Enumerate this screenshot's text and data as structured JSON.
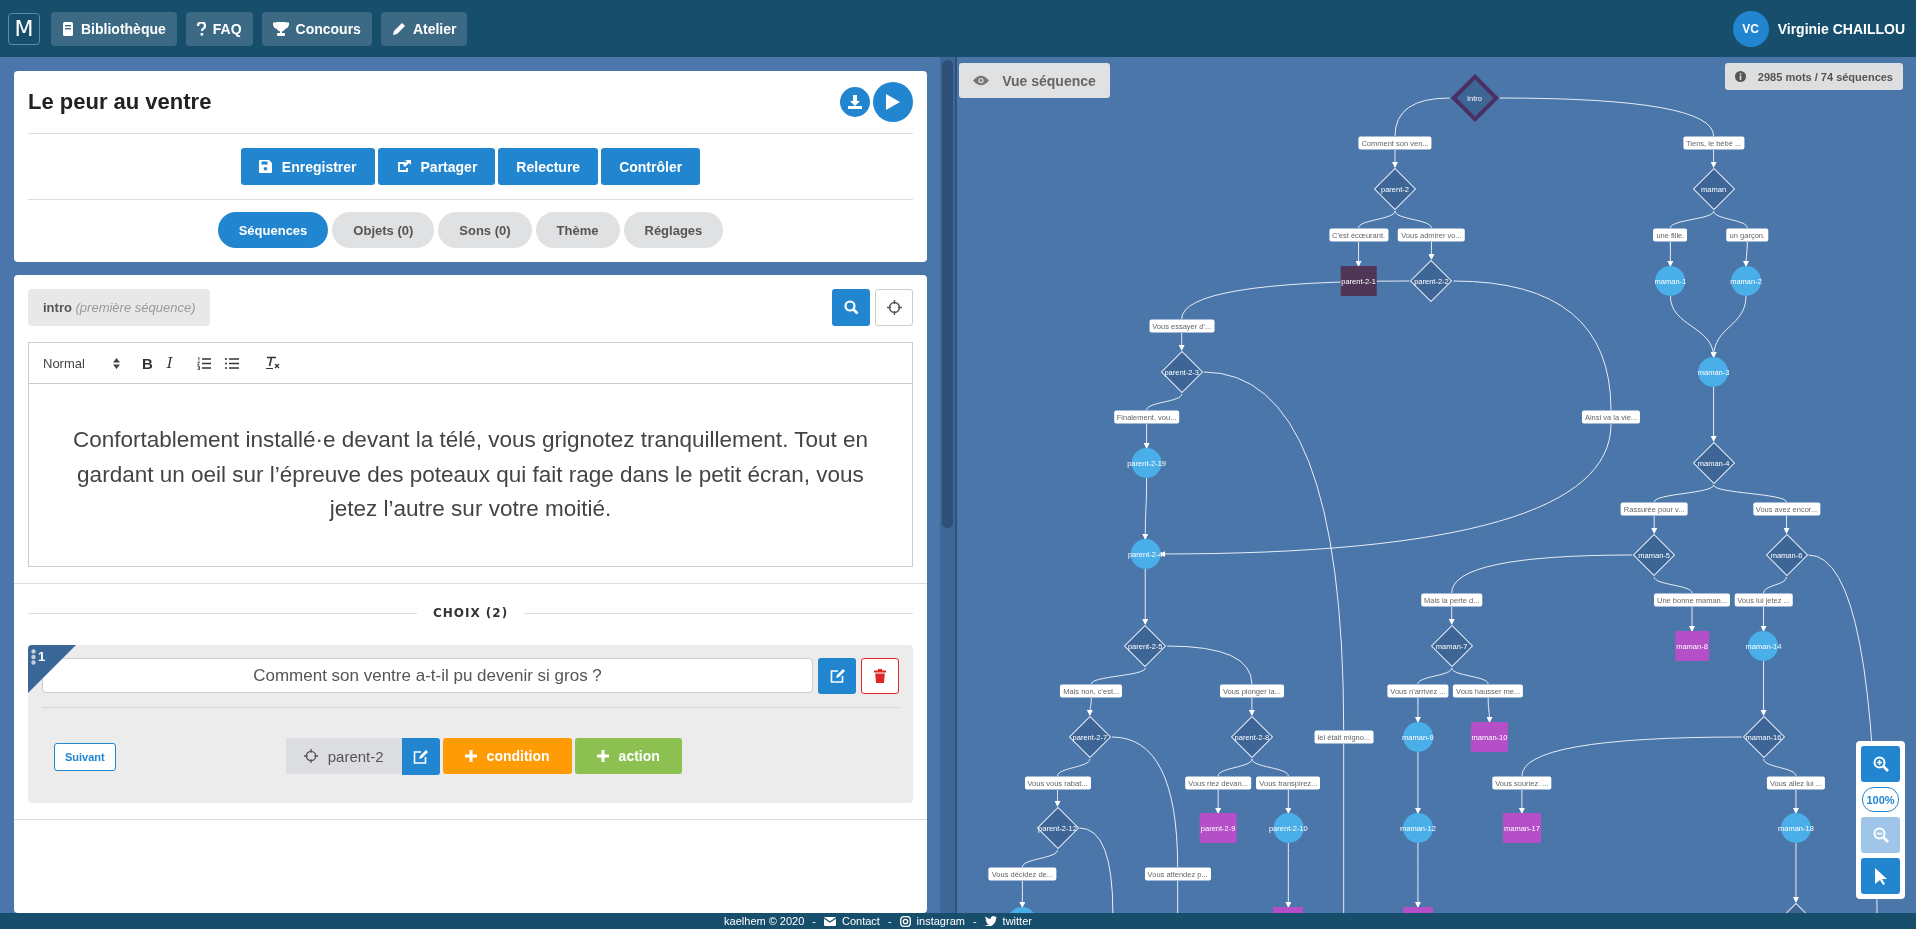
{
  "nav": {
    "logo": "M",
    "items": [
      {
        "label": "Bibliothèque"
      },
      {
        "label": "FAQ"
      },
      {
        "label": "Concours"
      },
      {
        "label": "Atelier"
      }
    ],
    "user": {
      "initials": "VC",
      "name": "Virginie CHAILLOU"
    }
  },
  "story": {
    "title": "Le peur au ventre",
    "actions": [
      "Enregistrer",
      "Partager",
      "Relecture",
      "Contrôler"
    ],
    "tabs": [
      {
        "label": "Séquences",
        "selected": true
      },
      {
        "label": "Objets (0)",
        "selected": false
      },
      {
        "label": "Sons (0)",
        "selected": false
      },
      {
        "label": "Thème",
        "selected": false
      },
      {
        "label": "Réglages",
        "selected": false
      }
    ]
  },
  "sequence": {
    "name": "intro",
    "note": "(première séquence)",
    "toolbar": {
      "format": "Normal",
      "marks": [
        "B",
        "I"
      ]
    },
    "text": "Confortablement installé·e devant la télé, vous grignotez tranquillement. Tout en gardant un oeil sur l’épreuve des poteaux qui fait rage dans le petit écran, vous jetez l’autre sur votre moitié.",
    "choices_heading": "CHOIX (2)",
    "choices": [
      {
        "number": "1",
        "text": "Comment son ventre a-t-il pu devenir si gros ?",
        "next_label": "Suivant",
        "target": "parent-2",
        "condition": "condition",
        "action": "action"
      }
    ]
  },
  "graph": {
    "view_button": "Vue séquence",
    "stats": "2985 mots / 74 séquences",
    "zoom": {
      "level": "100%",
      "zoom_out_disabled": true
    },
    "nodes": [
      {
        "label": "intro",
        "kind": "start"
      },
      {
        "label": "parent-2",
        "kind": "choice"
      },
      {
        "label": "parent-2-1",
        "kind": "end",
        "color": "#4f3657"
      },
      {
        "label": "parent-2-2",
        "kind": "choice"
      },
      {
        "label": "parent-2-3",
        "kind": "choice"
      },
      {
        "label": "parent-2-19",
        "kind": "sequence"
      },
      {
        "label": "maman",
        "kind": "choice"
      },
      {
        "label": "maman-1",
        "kind": "sequence"
      },
      {
        "label": "maman-2",
        "kind": "sequence"
      },
      {
        "label": "maman-3",
        "kind": "sequence"
      },
      {
        "label": "maman-4",
        "kind": "choice"
      },
      {
        "label": "parent-2-4",
        "kind": "sequence"
      },
      {
        "label": "maman-5",
        "kind": "choice"
      },
      {
        "label": "maman-6",
        "kind": "choice"
      },
      {
        "label": "parent-2-5",
        "kind": "choice"
      },
      {
        "label": "maman-7",
        "kind": "choice"
      },
      {
        "label": "maman-8",
        "kind": "end",
        "color": "#b44fc8"
      },
      {
        "label": "maman-14",
        "kind": "sequence"
      },
      {
        "label": "parent-2-7",
        "kind": "choice"
      },
      {
        "label": "parent-2-8",
        "kind": "choice"
      },
      {
        "label": "maman-9",
        "kind": "sequence"
      },
      {
        "label": "maman-10",
        "kind": "end",
        "color": "#b44fc8"
      },
      {
        "label": "maman-16",
        "kind": "choice"
      },
      {
        "label": "parent-2-12",
        "kind": "choice"
      },
      {
        "label": "parent-2-9",
        "kind": "end",
        "color": "#b44fc8"
      },
      {
        "label": "parent-2-10",
        "kind": "sequence"
      },
      {
        "label": "maman-12",
        "kind": "sequence"
      },
      {
        "label": "maman-17",
        "kind": "end",
        "color": "#b44fc8"
      },
      {
        "label": "maman-18",
        "kind": "sequence"
      },
      {
        "kind": "sequence"
      },
      {
        "kind": "end",
        "color": "#b44fc8"
      },
      {
        "kind": "end",
        "color": "#b44fc8"
      },
      {
        "kind": "choice"
      }
    ],
    "edge_labels": [
      "Comment son ven...",
      "Tiens, le bébé ...",
      "C'est écœurant.",
      "Vous admirer vo...",
      "une fille.",
      "un garçon.",
      "Vous essayer d'...",
      "Finalement, vou...",
      "Ainsi va la vie...",
      "Rassurée pour v...",
      "Vous avez encor...",
      "Mais la perte d...",
      "Une bonne maman...",
      "Vous lui jetez ...",
      "Mais non, c'est...",
      "Vous plonger la...",
      "Vous n'arrivez ...",
      "Vous hausser me...",
      "Iel était migno...",
      "Vous vous rabat...",
      "Vous riez devan...",
      "Vous transpirez...",
      "Vous souriez. ...",
      "Vous allez lui ...",
      "Vous décidez de...",
      "Vous attendez p..."
    ]
  },
  "footer": {
    "items": [
      {
        "kind": "text",
        "text": "kaelhem © 2020"
      },
      {
        "kind": "separator",
        "text": "-"
      },
      {
        "kind": "link",
        "text": "Contact"
      },
      {
        "kind": "separator",
        "text": "-"
      },
      {
        "kind": "link",
        "text": "instagram"
      },
      {
        "kind": "separator",
        "text": "-"
      },
      {
        "kind": "link",
        "text": "twitter"
      }
    ]
  }
}
